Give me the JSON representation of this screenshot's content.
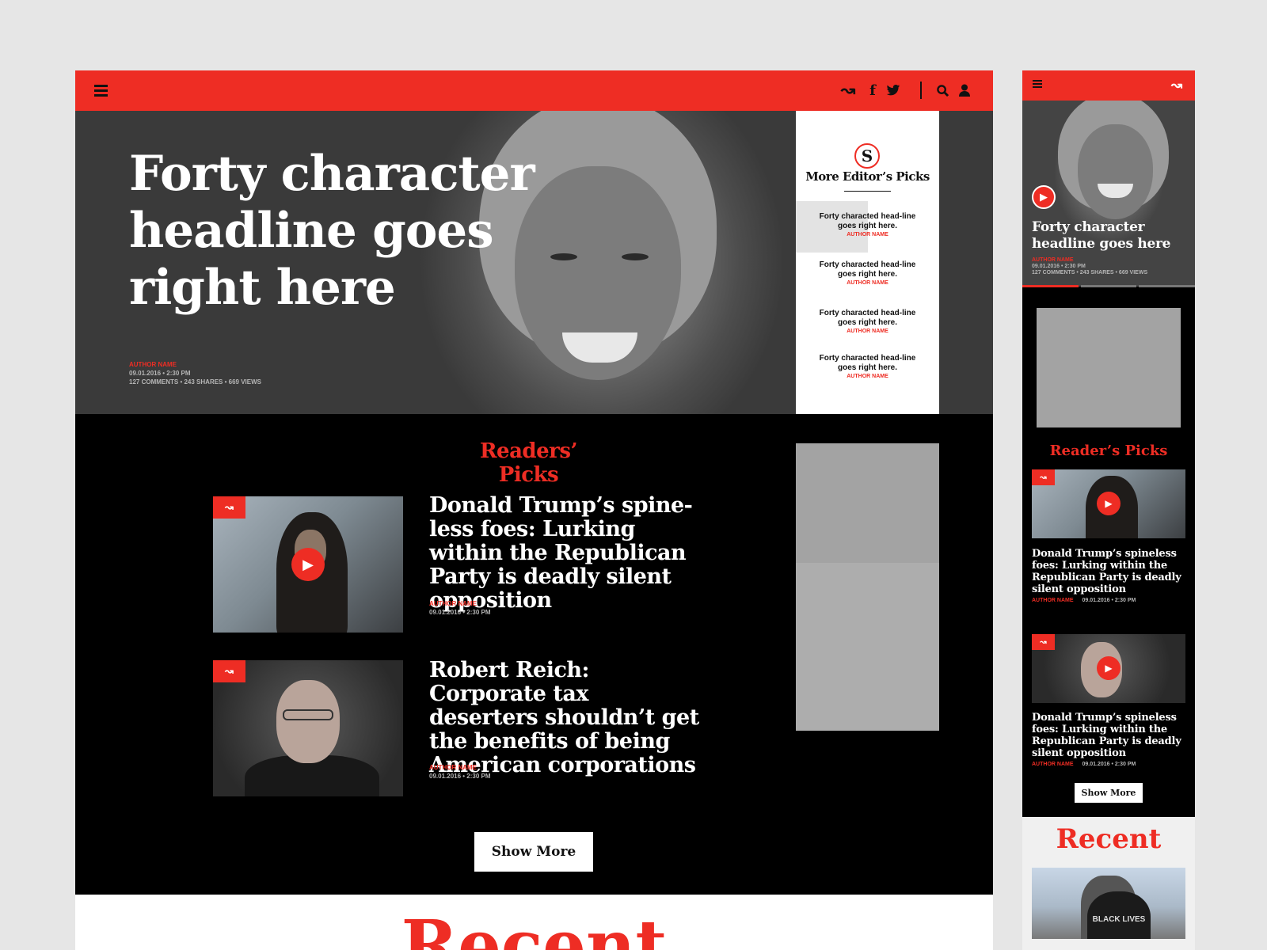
{
  "desktop": {
    "header": {
      "icons": [
        "menu-icon",
        "brand-arrow-icon",
        "facebook-icon",
        "twitter-icon",
        "search-icon",
        "user-icon"
      ],
      "facebook_glyph": "f",
      "twitter_glyph": "🐦",
      "brand_glyph": "↝",
      "search_glyph": "🔍",
      "user_glyph": "👤"
    },
    "hero": {
      "title": "Forty character headline goes right here",
      "author": "AUTHOR NAME",
      "date_time": "09.01.2016  •  2:30 PM",
      "stats": "127 COMMENTS  •  243 SHARES  •  669 VIEWS"
    },
    "editors_picks": {
      "logo_letter": "S",
      "title": "More Editor’s Picks",
      "items": [
        {
          "title": "Forty characted head-line goes right here.",
          "author": "AUTHOR NAME"
        },
        {
          "title": "Forty characted head-line goes right here.",
          "author": "AUTHOR NAME"
        },
        {
          "title": "Forty characted head-line goes right here.",
          "author": "AUTHOR NAME"
        },
        {
          "title": "Forty characted head-line goes right here.",
          "author": "AUTHOR NAME"
        }
      ]
    },
    "readers_picks": {
      "title": "Readers’ Picks",
      "articles": [
        {
          "title": "Donald Trump’s spine-less foes: Lurking within the Republican Party is deadly silent opposition",
          "author": "AUTHOR NAME",
          "date_time": "09.01.2016  •  2:30 PM"
        },
        {
          "title": "Robert Reich: Corporate tax deserters shouldn’t get the benefits of being American corporations",
          "author": "AUTHOR NAME",
          "date_time": "09.01.2016  •  2:30 PM"
        }
      ],
      "show_more": "Show More"
    },
    "recent_title": "Recent"
  },
  "mobile": {
    "hero": {
      "title": "Forty character headline goes here",
      "author": "AUTHOR NAME",
      "date_time": "09.01.2016  •  2:30 PM",
      "stats": "127 COMMENTS  •  243 SHARES  •  669 VIEWS",
      "slide_count": 3,
      "active_slide": 1
    },
    "readers_picks": {
      "title": "Reader’s Picks",
      "articles": [
        {
          "title": "Donald Trump’s spineless foes: Lurking within the Republican Party is deadly silent opposition",
          "author": "AUTHOR NAME",
          "date_time": "09.01.2016  •  2:30 PM"
        },
        {
          "title": "Donald Trump’s spineless foes: Lurking within the Republican Party is deadly silent opposition",
          "author": "AUTHOR NAME",
          "date_time": "09.01.2016  •  2:30 PM"
        }
      ],
      "show_more": "Show More"
    },
    "recent_title": "Recent",
    "recent_thumb_text": "BLACK LIVES"
  },
  "colors": {
    "accent": "#ee2d24",
    "background": "#e6e6e6",
    "dark": "#000000",
    "ad_placeholder": "#a3a3a3"
  }
}
